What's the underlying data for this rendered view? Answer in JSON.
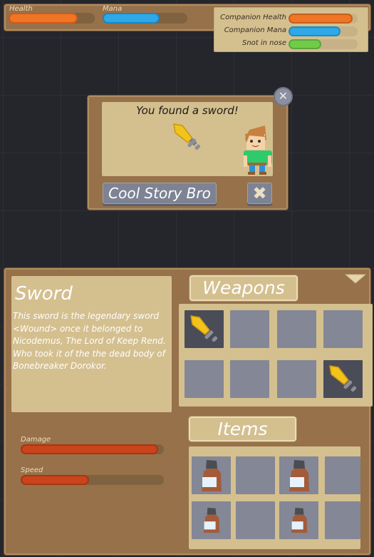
{
  "hud": {
    "health": {
      "label": "Health",
      "value": 0.8,
      "color": "#f07524"
    },
    "mana": {
      "label": "Mana",
      "value": 0.67,
      "color": "#2ea8e6"
    }
  },
  "companion": {
    "rows": [
      {
        "label": "Companion Health",
        "value": 0.93,
        "color": "#f07524"
      },
      {
        "label": "Companion Mana",
        "value": 0.75,
        "color": "#2ea8e6"
      },
      {
        "label": "Snot in nose",
        "value": 0.47,
        "color": "#70cc48"
      }
    ]
  },
  "dialog": {
    "message": "You found a sword!",
    "confirm_label": "Cool Story Bro",
    "item_icon": "sword-icon",
    "character": "boy-character"
  },
  "item_detail": {
    "title": "Sword",
    "description": "This sword is the legendary sword <Wound> once it belonged to Nicodemus, The Lord of Keep Rend. Who took it of the the dead body of Bonebreaker Dorokor.",
    "stats": [
      {
        "label": "Damage",
        "value": 0.96,
        "color": "#c9441c"
      },
      {
        "label": "Speed",
        "value": 0.48,
        "color": "#c9441c"
      }
    ]
  },
  "weapons": {
    "title": "Weapons",
    "slots": [
      "sword",
      "",
      "",
      "",
      "",
      "",
      "",
      "sword"
    ]
  },
  "items": {
    "title": "Items",
    "slots": [
      "potion",
      "",
      "potion",
      "",
      "potion-small",
      "",
      "potion-small",
      ""
    ]
  }
}
